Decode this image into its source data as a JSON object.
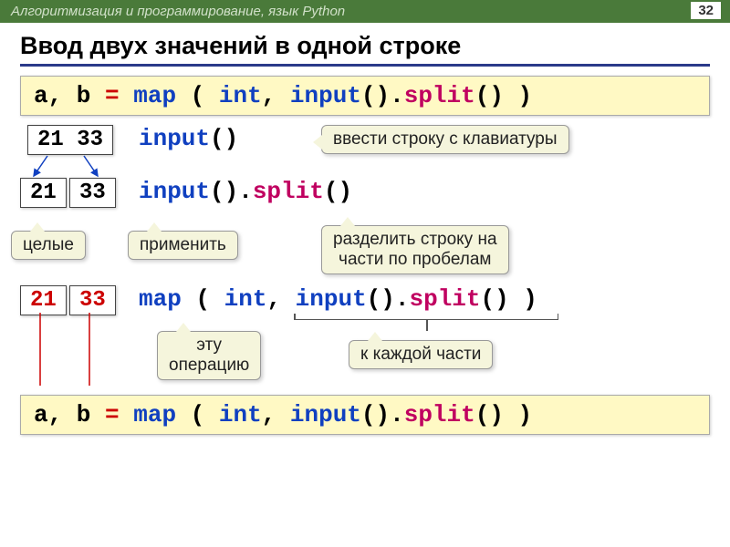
{
  "header": {
    "breadcrumb": "Алгоритмизация и программирование, язык Python",
    "page": "32"
  },
  "title": "Ввод двух значений в одной строке",
  "code1": {
    "ab": "a, b",
    "eq": " = ",
    "map": "map",
    "open": " ( ",
    "int": "int",
    "comma": ", ",
    "input": "input",
    "par": "().",
    "split": "split",
    "close": "() )"
  },
  "step1": {
    "raw": "21 33",
    "fn": "input",
    "suffix": "()"
  },
  "callout_input": "ввести строку с клавиатуры",
  "step2": {
    "a": "21",
    "b": "33",
    "fn1": "input",
    "mid": "().",
    "fn2": "split",
    "suffix": "()"
  },
  "callout_int": "целые",
  "callout_apply": "применить",
  "callout_split": "разделить строку на\nчасти по пробелам",
  "step3": {
    "a": "21",
    "b": "33",
    "map": "map",
    "open": " ( ",
    "int": "int",
    "comma": ", ",
    "input": "input",
    "mid": "().",
    "split": "split",
    "close": "() )"
  },
  "callout_op": "эту\nоперацию",
  "callout_each": "к каждой части",
  "code2": {
    "ab": "a, b",
    "eq": " = ",
    "map": "map",
    "open": " ( ",
    "int": "int",
    "comma": ", ",
    "input": "input",
    "par": "().",
    "split": "split",
    "close": "() )"
  }
}
